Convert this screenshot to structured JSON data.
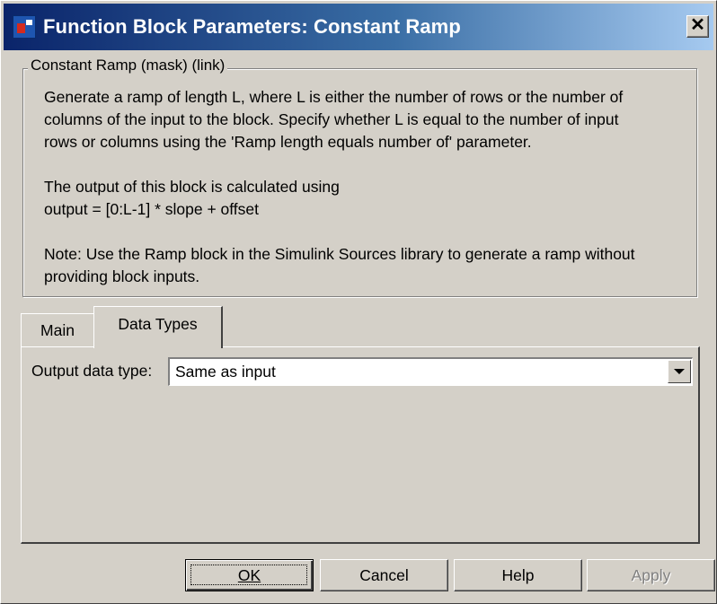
{
  "window": {
    "title": "Function Block Parameters: Constant Ramp",
    "close_glyph": "✕",
    "icons": [
      "simulink-block-icon",
      "close-icon",
      "chevron-down-icon"
    ]
  },
  "mask": {
    "group_title": "Constant Ramp (mask) (link)",
    "description": [
      "Generate a ramp of length L, where L is either the number of rows or the number of",
      "columns of the input to the block.  Specify whether L is equal to the number of input",
      "rows or columns using the 'Ramp length equals number of' parameter.",
      "",
      "The output of this block is calculated using",
      "output = [0:L-1] * slope + offset",
      "",
      "Note: Use the Ramp block in the Simulink Sources library to generate a ramp without",
      "providing block inputs."
    ]
  },
  "tabs": [
    {
      "label": "Main",
      "active": false
    },
    {
      "label": "Data Types",
      "active": true
    }
  ],
  "data_types": {
    "output_label": "Output data type:",
    "output_value": "Same as input"
  },
  "buttons": {
    "ok": "OK",
    "cancel": "Cancel",
    "help": "Help",
    "apply": "Apply"
  },
  "colors": {
    "face": "#d4d0c8",
    "title_gradient_start": "#0a246a",
    "title_gradient_end": "#a6caf0",
    "disabled_text": "#808080"
  }
}
